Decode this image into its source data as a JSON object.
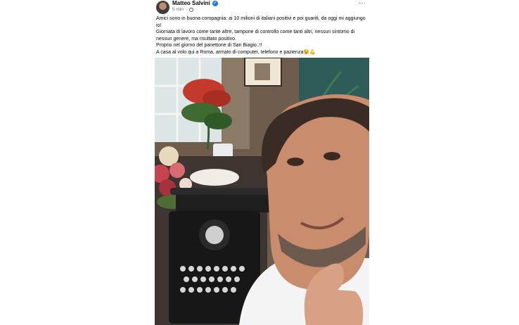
{
  "post": {
    "author": "Matteo Salvini",
    "timestamp": "5 min",
    "separator": "·",
    "more_label": "···",
    "lines": [
      "Amici sono in buona compagnia: ai 10 milioni di italiani positivi e poi guariti, da oggi mi aggiungo io!",
      "Giornata di lavoro come tante altre, tampone di controllo come tanti altri, nessun sintomo di nessun genere, ma risultato positivo.",
      "Proprio nel giorno del panettone di San Biagio..!!",
      "A casa al volo qui a Roma, armato di computer, telefono e pazienza😉💪"
    ]
  },
  "icons": {
    "verified": "verified-badge-icon",
    "privacy": "globe-icon",
    "more": "more-options-icon"
  },
  "colors": {
    "verified": "#1877f2",
    "text": "#050505",
    "meta": "#65676b"
  }
}
